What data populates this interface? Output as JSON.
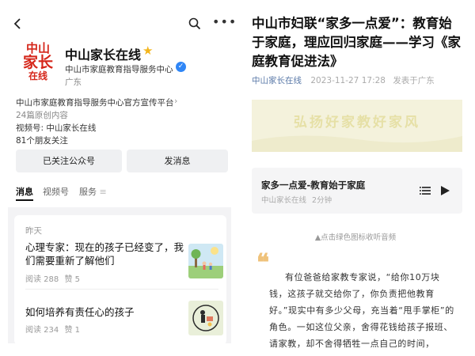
{
  "left": {
    "account": {
      "logo_line1": "中山",
      "logo_line2": "家长",
      "logo_line3": "在线",
      "name": "中山家长在线",
      "org": "中山市家庭教育指导服务中心",
      "location": "广东"
    },
    "profile": {
      "description": "中山市家庭教育指导服务中心官方宣传平台",
      "original_count": "24篇原创内容",
      "video_channel": "视频号: 中山家长在线",
      "friends_following": "81个朋友关注"
    },
    "buttons": {
      "follow_label": "已关注公众号",
      "message_label": "发消息"
    },
    "tabs": [
      {
        "label": "消息"
      },
      {
        "label": "视频号"
      },
      {
        "label": "服务"
      }
    ],
    "feed": {
      "day_label": "昨天",
      "articles": [
        {
          "title": "心理专家：现在的孩子已经变了，我们需要重新了解他们",
          "reads": "阅读 288",
          "likes": "赞 5"
        },
        {
          "title": "如何培养有责任心的孩子",
          "reads": "阅读 234",
          "likes": "赞 1"
        }
      ]
    }
  },
  "right": {
    "article": {
      "title": "中山市妇联“家多一点爱”：教育始于家庭，理应回归家庭——学习《家庭教育促进法》",
      "source": "中山家长在线",
      "date": "2023-11-27 17:28",
      "location": "发表于广东"
    },
    "banner_text": "弘扬好家教好家风",
    "audio": {
      "title": "家多一点爱-教育始于家庭",
      "channel": "中山家长在线",
      "duration": "2分钟"
    },
    "collapse_hint": "▲点击绿色图标收听音频",
    "paragraph": "有位爸爸给家教专家说，“给你10万块钱，这孩子就交给你了，你负责把他教育好。”现实中有多少父母，充当着“甩手掌柜”的角色。一如这位父亲，舍得花钱给孩子报班、请家教，却不舍得牺牲一点自己的时间，"
  },
  "colors": {
    "logo_red": "#d5261a",
    "star_gold": "#f3b51c",
    "verified_blue": "#2f86f6",
    "source_link": "#5a79a8",
    "quote_mark": "#efc27a",
    "banner_bg": "#f3f1d8"
  },
  "icons": [
    "back-chevron-icon",
    "search-icon",
    "more-icon",
    "star-icon",
    "verified-icon",
    "chevron-right-icon",
    "playlist-icon",
    "play-icon",
    "quote-icon"
  ]
}
